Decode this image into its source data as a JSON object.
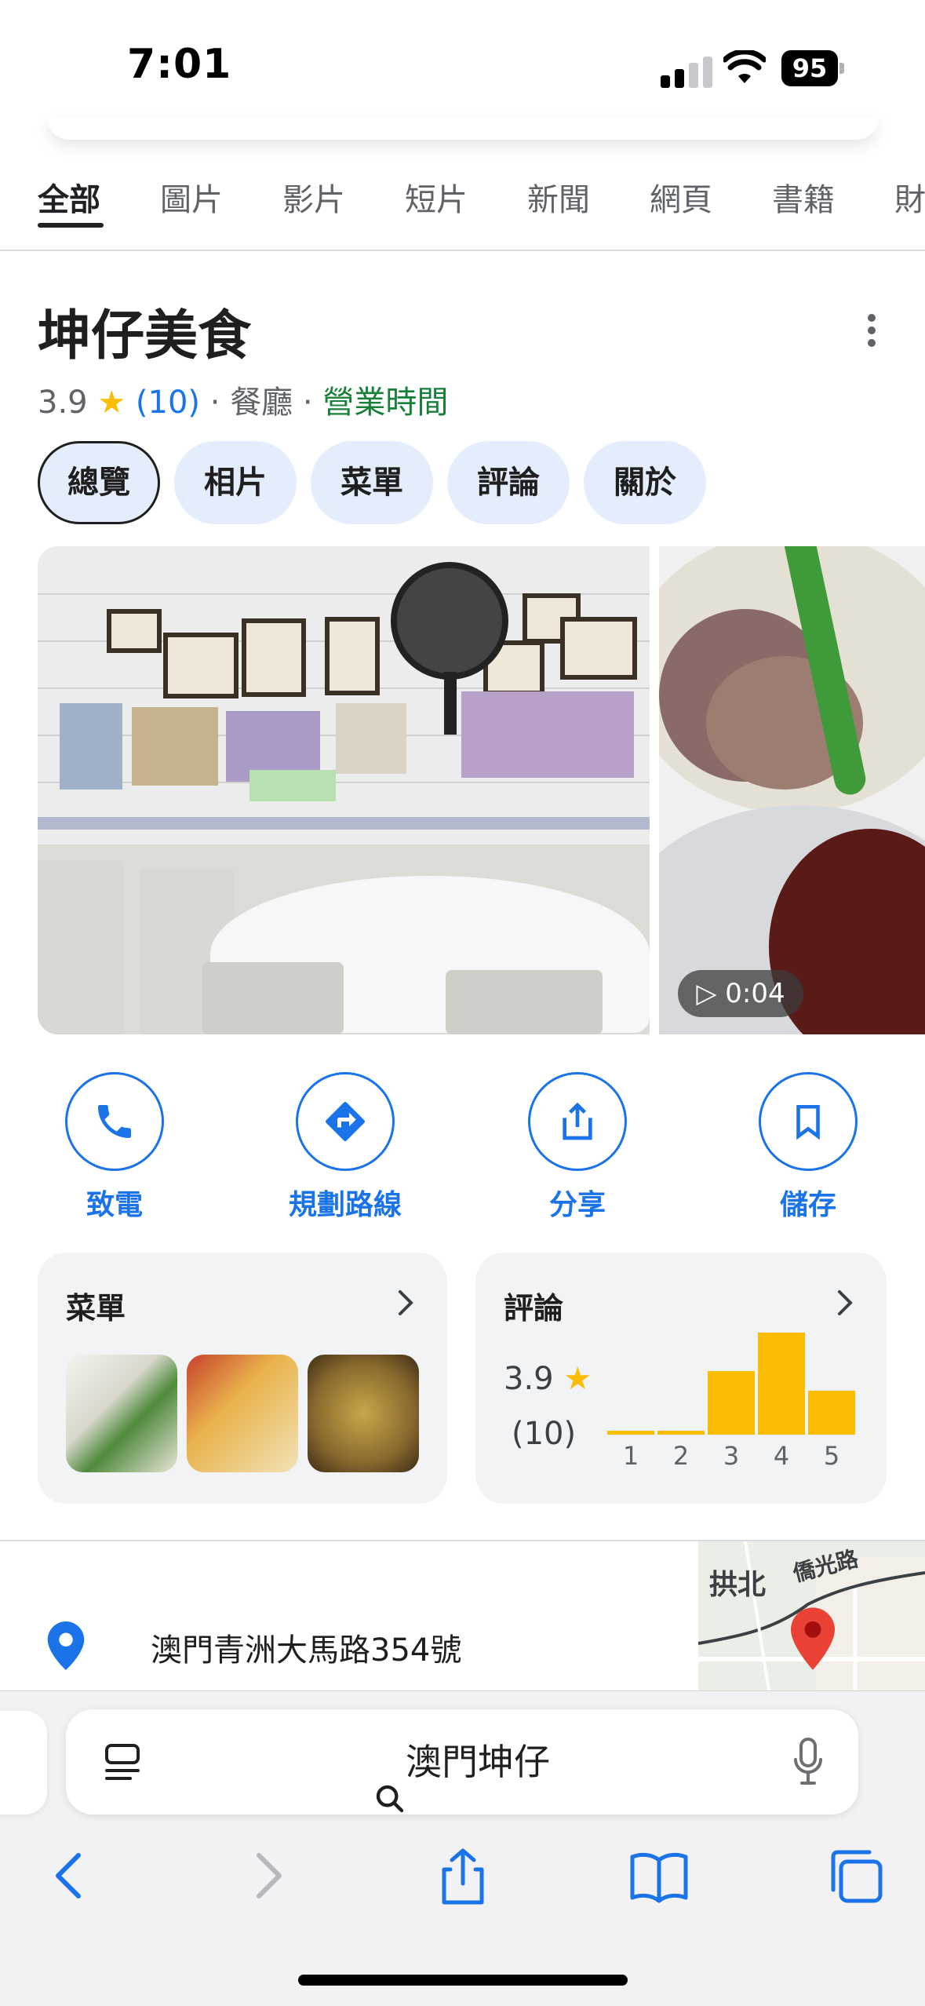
{
  "status_bar": {
    "time": "7:01",
    "battery": "95"
  },
  "tabs": [
    "全部",
    "圖片",
    "影片",
    "短片",
    "新聞",
    "網頁",
    "書籍",
    "財"
  ],
  "place": {
    "title": "坤仔美食",
    "rating": "3.9",
    "review_count": "(10)",
    "category": "餐廳",
    "hours_label": "營業時間"
  },
  "chips": [
    "總覽",
    "相片",
    "菜單",
    "評論",
    "關於"
  ],
  "video_duration": "0:04",
  "actions": {
    "call": "致電",
    "directions": "規劃路線",
    "share": "分享",
    "save": "儲存"
  },
  "menu_card": {
    "title": "菜單"
  },
  "review_card": {
    "title": "評論",
    "score": "3.9",
    "count": "(10)",
    "histogram": {
      "labels": [
        "1",
        "2",
        "3",
        "4",
        "5"
      ],
      "values": [
        0.04,
        0.04,
        0.62,
        1.0,
        0.43
      ]
    }
  },
  "address": "澳門青洲大馬路354號",
  "map_labels": {
    "area": "拱北",
    "road": "僑光路"
  },
  "browser": {
    "query": "澳門坤仔"
  },
  "colors": {
    "accent": "#1a73e8",
    "star": "#fbbc04",
    "open": "#188038",
    "chip_bg": "#e3edfb"
  }
}
